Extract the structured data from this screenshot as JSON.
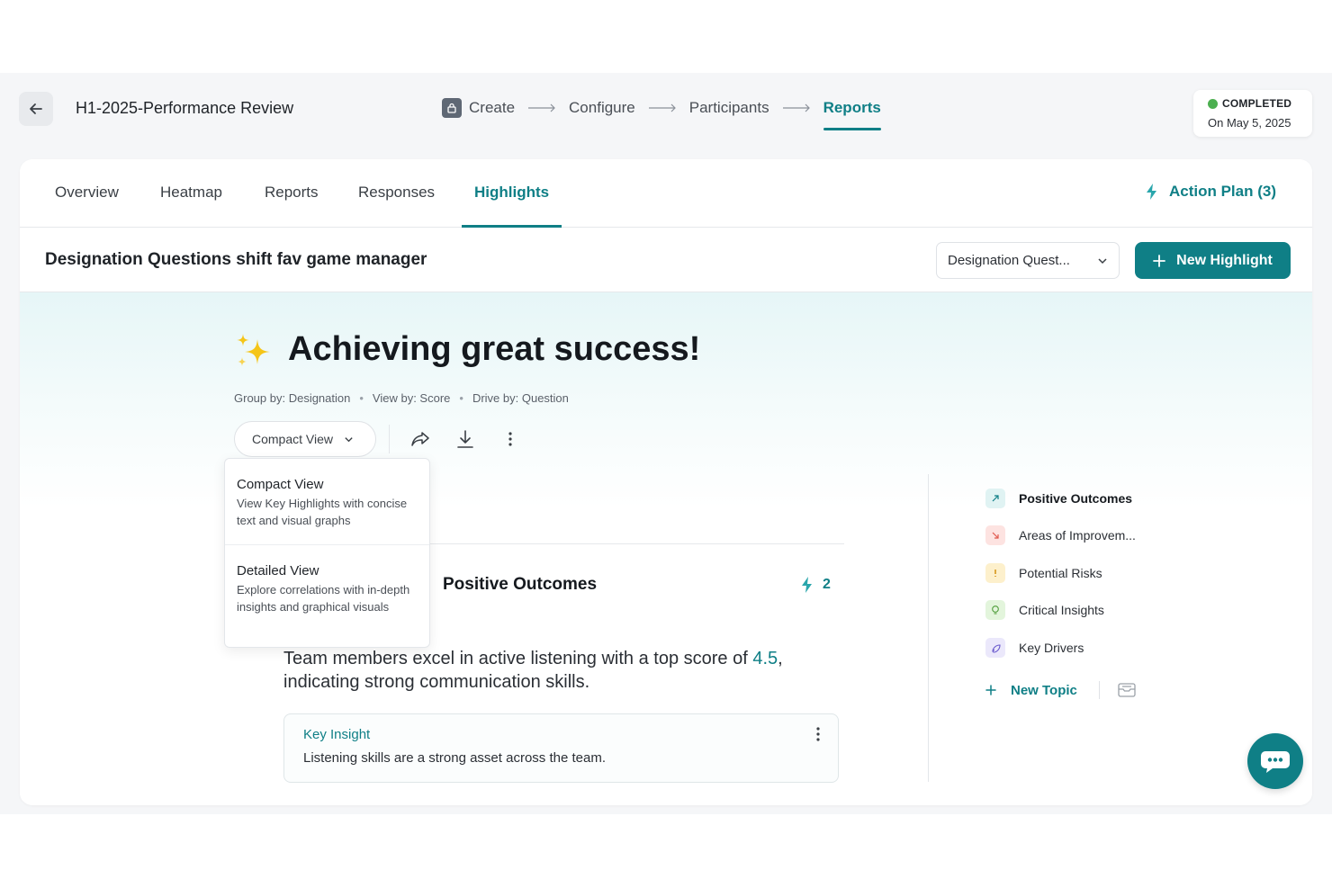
{
  "header": {
    "title": "H1-2025-Performance Review",
    "steps": [
      {
        "label": "Create"
      },
      {
        "label": "Configure"
      },
      {
        "label": "Participants"
      },
      {
        "label": "Reports"
      }
    ],
    "status": {
      "label": "COMPLETED",
      "date": "On May 5, 2025",
      "color": "#4caf50"
    }
  },
  "tabs": [
    {
      "label": "Overview"
    },
    {
      "label": "Heatmap"
    },
    {
      "label": "Reports"
    },
    {
      "label": "Responses"
    },
    {
      "label": "Highlights"
    }
  ],
  "action_plan": {
    "label": "Action Plan (3)"
  },
  "subheader": {
    "title": "Designation Questions shift fav game manager",
    "select_value": "Designation Quest...",
    "new_highlight_label": "New Highlight"
  },
  "highlight": {
    "headline": "Achieving great success!",
    "meta": {
      "group_by": "Group by: Designation",
      "view_by": "View by: Score",
      "drive_by": "Drive by: Question"
    },
    "view_selector": "Compact View",
    "dropdown": [
      {
        "title": "Compact View",
        "desc": "View Key Highlights with concise text and visual graphs"
      },
      {
        "title": "Detailed View",
        "desc": "Explore correlations with in-depth insights and graphical visuals"
      }
    ],
    "section_title": "Positive Outcomes",
    "count": "2",
    "statement_prefix": "Team members excel in active listening with a top score of ",
    "statement_score": "4.5",
    "statement_suffix": ", indicating strong communication skills.",
    "insight_label": "Key Insight",
    "insight_text": "Listening skills are a strong asset across the team."
  },
  "topics": [
    {
      "label": "Positive Outcomes",
      "icon": "arrow-up-right-icon",
      "bg": "#e0f3f3",
      "fg": "#0f7f86"
    },
    {
      "label": "Areas of Improvem...",
      "icon": "arrow-down-icon",
      "bg": "#fde3e1",
      "fg": "#e0584e"
    },
    {
      "label": "Potential Risks",
      "icon": "warning-icon",
      "bg": "#fdf0cc",
      "fg": "#d08a00"
    },
    {
      "label": "Critical Insights",
      "icon": "bulb-icon",
      "bg": "#e3f5dc",
      "fg": "#4f9d3a"
    },
    {
      "label": "Key Drivers",
      "icon": "rocket-icon",
      "bg": "#ebe8fb",
      "fg": "#6a5acd"
    }
  ],
  "new_topic_label": "New Topic",
  "colors": {
    "accent": "#0f7f86"
  }
}
